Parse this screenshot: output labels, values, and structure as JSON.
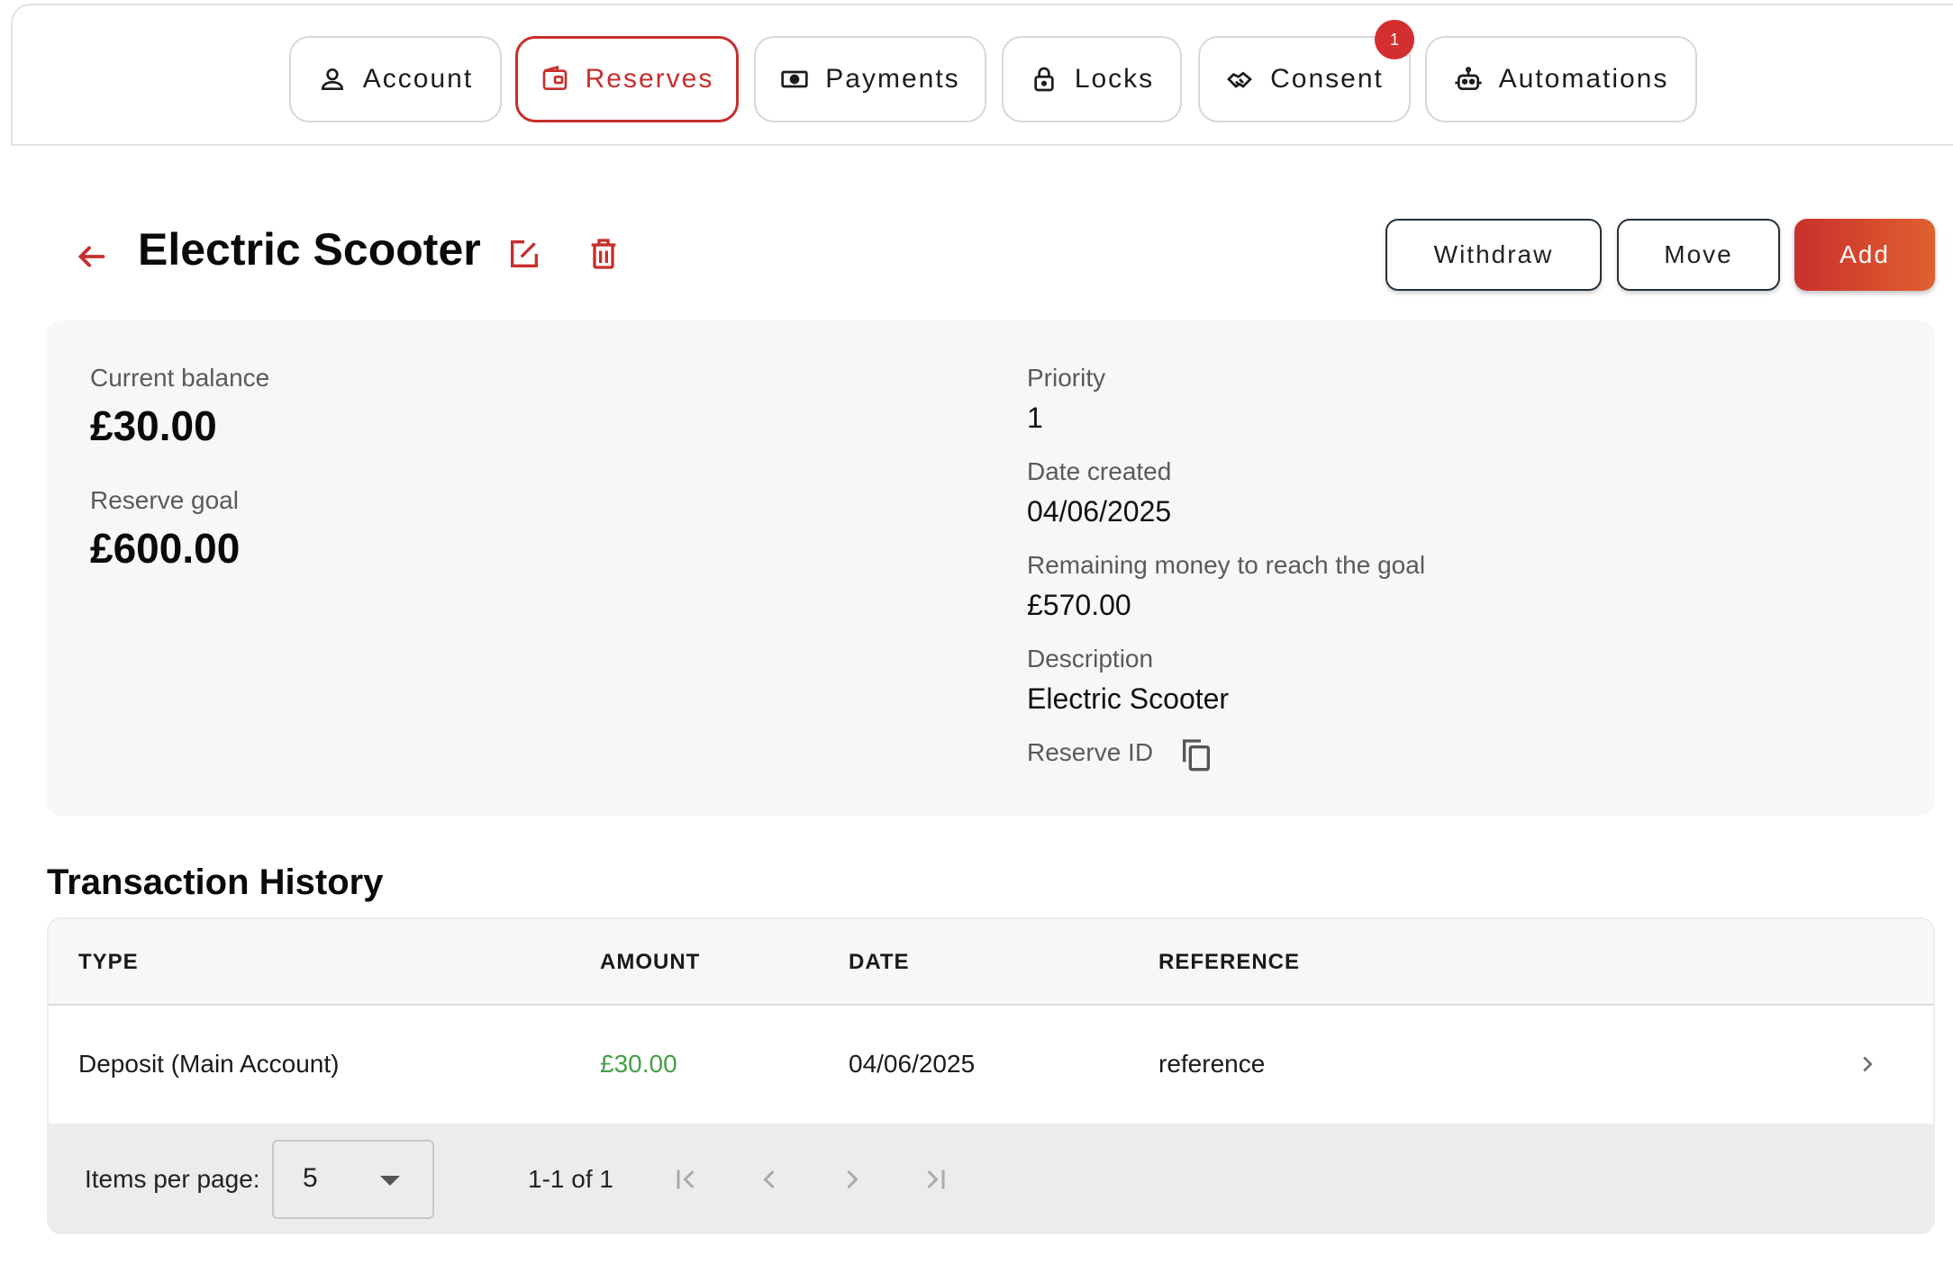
{
  "tabs": [
    {
      "label": "Account",
      "icon": "person-icon",
      "active": false
    },
    {
      "label": "Reserves",
      "icon": "wallet-icon",
      "active": true
    },
    {
      "label": "Payments",
      "icon": "money-icon",
      "active": false
    },
    {
      "label": "Locks",
      "icon": "lock-icon",
      "active": false
    },
    {
      "label": "Consent",
      "icon": "handshake-icon",
      "active": false,
      "badge": "1"
    },
    {
      "label": "Automations",
      "icon": "robot-icon",
      "active": false
    }
  ],
  "header": {
    "title": "Electric Scooter",
    "withdraw_label": "Withdraw",
    "move_label": "Move",
    "add_label": "Add"
  },
  "details": {
    "current_balance_label": "Current balance",
    "current_balance": "£30.00",
    "reserve_goal_label": "Reserve goal",
    "reserve_goal": "£600.00",
    "priority_label": "Priority",
    "priority": "1",
    "date_created_label": "Date created",
    "date_created": "04/06/2025",
    "remaining_label": "Remaining money to reach the goal",
    "remaining": "£570.00",
    "description_label": "Description",
    "description": "Electric Scooter",
    "reserve_id_label": "Reserve ID"
  },
  "transactions": {
    "title": "Transaction History",
    "columns": [
      "TYPE",
      "AMOUNT",
      "DATE",
      "REFERENCE"
    ],
    "rows": [
      {
        "type": "Deposit (Main Account)",
        "amount": "£30.00",
        "date": "04/06/2025",
        "reference": "reference"
      }
    ],
    "paginator": {
      "items_per_page_label": "Items per page:",
      "items_per_page": "5",
      "range": "1-1 of 1"
    }
  },
  "colors": {
    "accent": "#c62f2c",
    "amount_positive": "#43a047",
    "card_bg": "#f7f7f7"
  }
}
